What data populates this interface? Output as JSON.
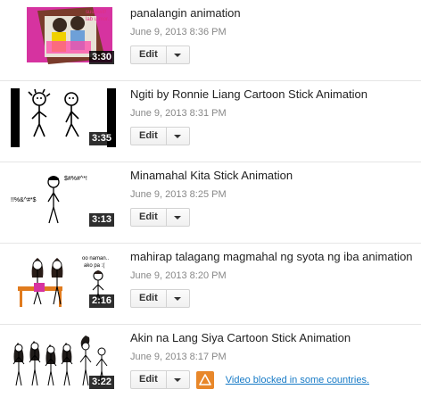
{
  "videos": [
    {
      "title": "panalangin animation",
      "date": "June 9, 2013 8:36 PM",
      "duration": "3:30",
      "edit_label": "Edit",
      "thumb_text": [
        "suuwwit!",
        "lab u mor.."
      ]
    },
    {
      "title": "Ngiti by Ronnie Liang Cartoon Stick Animation",
      "date": "June 9, 2013 8:31 PM",
      "duration": "3:35",
      "edit_label": "Edit"
    },
    {
      "title": "Minamahal Kita Stick Animation",
      "date": "June 9, 2013 8:25 PM",
      "duration": "3:13",
      "edit_label": "Edit",
      "thumb_text": [
        "$#%#^*!",
        "!!%&^#*$"
      ]
    },
    {
      "title": "mahirap talagang magmahal ng syota ng iba animation",
      "date": "June 9, 2013 8:20 PM",
      "duration": "2:16",
      "edit_label": "Edit",
      "thumb_text": [
        "oo naman..",
        "ako pa :("
      ]
    },
    {
      "title": "Akin na Lang Siya Cartoon Stick Animation",
      "date": "June 9, 2013 8:17 PM",
      "duration": "3:22",
      "edit_label": "Edit",
      "notice": "Video blocked in some countries."
    }
  ],
  "colors": {
    "link": "#167ac6",
    "warning": "#e8872a",
    "pink": "#e040a0"
  },
  "icons": {
    "warning": "warning-triangle-icon",
    "dropdown": "chevron-down-icon"
  }
}
